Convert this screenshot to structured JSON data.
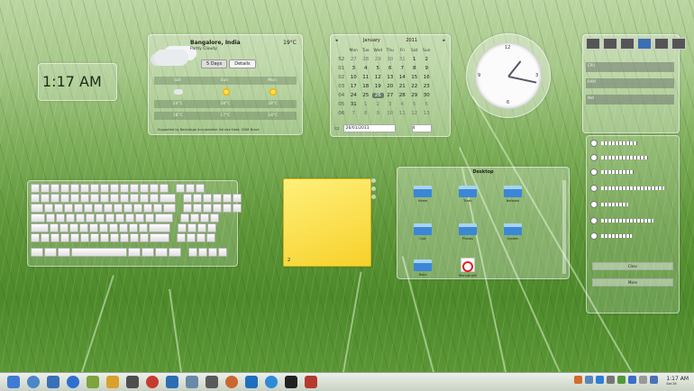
{
  "clock": {
    "time": "1:17 AM"
  },
  "weather": {
    "city": "Bangalore, India",
    "observed": "Partly Cloudy",
    "temp": "19°C",
    "tabs": [
      "5 Days",
      "Details"
    ],
    "days": [
      "Sat",
      "Sun",
      "Mon"
    ],
    "highs": [
      "24°C",
      "28°C",
      "28°C"
    ],
    "lows": [
      "18°C",
      "17°C",
      "18°C"
    ],
    "footer": "Supported by Backstage Accuweather Service Data: 2008 Brace"
  },
  "calendar": {
    "month": "January",
    "year": "2011",
    "weekday_headers": [
      "Mon",
      "Tue",
      "Wed",
      "Thu",
      "Fri",
      "Sat",
      "Sun"
    ],
    "rows": [
      {
        "week": "52",
        "days": [
          "27",
          "28",
          "29",
          "30",
          "31",
          "1",
          "2"
        ]
      },
      {
        "week": "01",
        "days": [
          "3",
          "4",
          "5",
          "6",
          "7",
          "8",
          "9"
        ]
      },
      {
        "week": "02",
        "days": [
          "10",
          "11",
          "12",
          "13",
          "14",
          "15",
          "16"
        ]
      },
      {
        "week": "03",
        "days": [
          "17",
          "18",
          "19",
          "20",
          "21",
          "22",
          "23"
        ]
      },
      {
        "week": "04",
        "days": [
          "24",
          "25",
          "26",
          "27",
          "28",
          "29",
          "30"
        ]
      },
      {
        "week": "05",
        "days": [
          "31",
          "1",
          "2",
          "3",
          "4",
          "5",
          "6"
        ]
      },
      {
        "week": "06",
        "days": [
          "7",
          "8",
          "9",
          "10",
          "11",
          "12",
          "13"
        ]
      }
    ],
    "today": "26",
    "date_field": "26/01/2011",
    "week_field": "4"
  },
  "analog_clock": {
    "numerals": [
      "12",
      "3",
      "6",
      "9"
    ],
    "hour": 1,
    "minute": 17
  },
  "sysmon": {
    "labels": [
      "CPU",
      "RAM",
      "Net"
    ]
  },
  "notes": {
    "counter": "2"
  },
  "folder": {
    "title": "Desktop",
    "items": [
      "Home",
      "Trash",
      "Network",
      "Calc",
      "Photos",
      "System",
      "Docs",
      "Manual.pdf"
    ]
  },
  "notifications": {
    "buttons": [
      "Clear",
      "More"
    ]
  },
  "panel": {
    "time": "1:17 AM",
    "date": "Sat 26"
  }
}
